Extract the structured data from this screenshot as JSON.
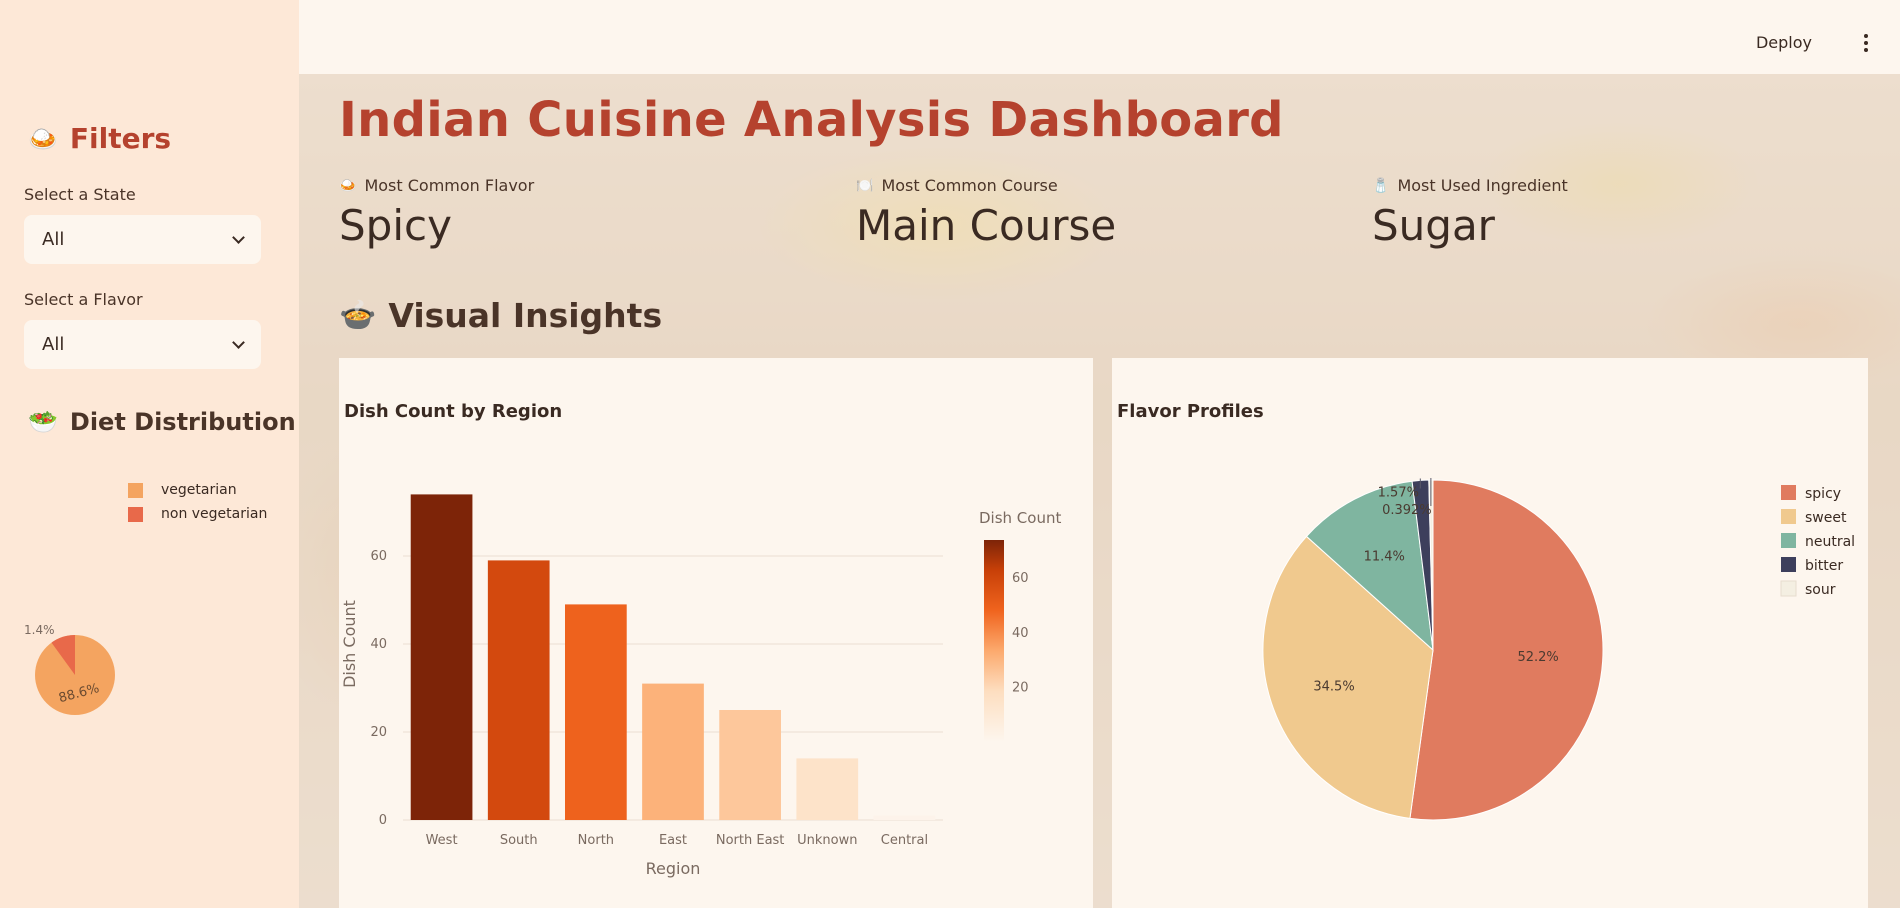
{
  "sidebar": {
    "filters_title": "Filters",
    "state_label": "Select a State",
    "state_value": "All",
    "flavor_label": "Select a Flavor",
    "flavor_value": "All",
    "diet_title": "Diet Distribution",
    "diet_legend": [
      {
        "label": "vegetarian",
        "color": "#f4a460"
      },
      {
        "label": "non vegetarian",
        "color": "#e8694a"
      }
    ],
    "diet_pct_small": "1.4%",
    "diet_pct_large": "88.6%"
  },
  "header": {
    "deploy": "Deploy"
  },
  "main": {
    "title": "Indian Cuisine Analysis Dashboard",
    "metrics": [
      {
        "label": "Most Common Flavor",
        "value": "Spicy"
      },
      {
        "label": "Most Common Course",
        "value": "Main Course"
      },
      {
        "label": "Most Used Ingredient",
        "value": "Sugar"
      }
    ],
    "section_title": "Visual Insights"
  },
  "chart_data": [
    {
      "type": "bar",
      "title": "Dish Count by Region",
      "categories": [
        "West",
        "South",
        "North",
        "East",
        "North East",
        "Unknown",
        "Central"
      ],
      "values": [
        74,
        59,
        49,
        31,
        25,
        14,
        1
      ],
      "xlabel": "Region",
      "ylabel": "Dish Count",
      "ylim": [
        0,
        80
      ],
      "yticks": [
        0,
        20,
        40,
        60
      ],
      "colorbar_title": "Dish Count",
      "colorbar_ticks": [
        20,
        40,
        60
      ],
      "grid": true
    },
    {
      "type": "pie",
      "title": "Flavor Profiles",
      "labels": [
        "spicy",
        "sweet",
        "neutral",
        "bitter",
        "sour"
      ],
      "values": [
        52.2,
        34.5,
        11.4,
        1.57,
        0.392
      ],
      "value_labels": [
        "52.2%",
        "34.5%",
        "11.4%",
        "1.57%",
        "0.392%"
      ],
      "colors": [
        "#e07b5f",
        "#f0c98e",
        "#7fb5a0",
        "#3d3f5c",
        "#f4efe2"
      ],
      "legend": "right"
    }
  ]
}
